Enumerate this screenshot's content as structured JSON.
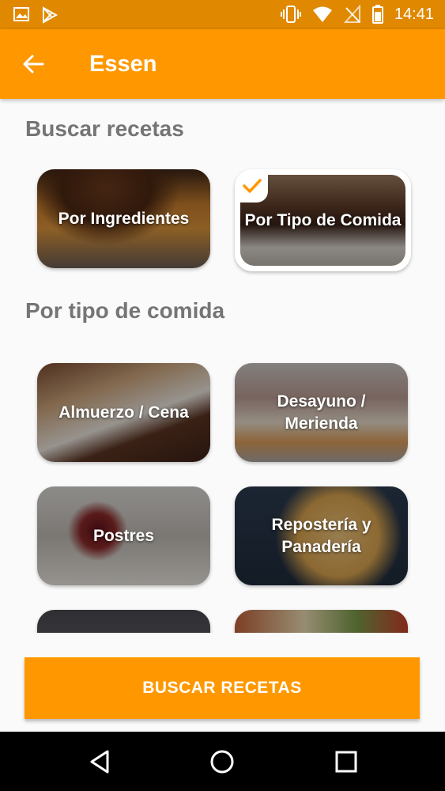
{
  "status_bar": {
    "time": "14:41"
  },
  "app_bar": {
    "title": "Essen"
  },
  "sections": {
    "search_heading": "Buscar recetas",
    "type_heading": "Por tipo de comida"
  },
  "search_modes": [
    {
      "label": "Por Ingredientes",
      "selected": false
    },
    {
      "label": "Por Tipo de Comida",
      "selected": true
    }
  ],
  "meal_types": [
    {
      "label": "Almuerzo / Cena"
    },
    {
      "label": "Desayuno / Merienda"
    },
    {
      "label": "Postres"
    },
    {
      "label": "Repostería y Panadería"
    },
    {
      "label": ""
    },
    {
      "label": ""
    }
  ],
  "search_button": {
    "label": "BUSCAR RECETAS"
  },
  "colors": {
    "primary": "#ff9800",
    "status_bar": "#e08800",
    "heading": "#757575"
  }
}
